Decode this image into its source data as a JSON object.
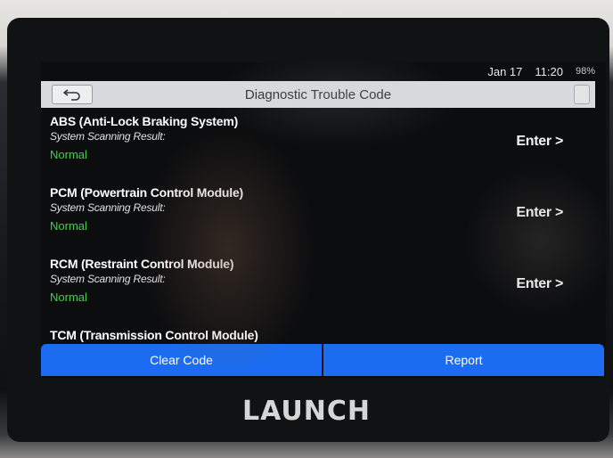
{
  "status_bar": {
    "date": "Jan 17",
    "time": "11:20",
    "battery": "98%"
  },
  "header": {
    "title": "Diagnostic Trouble Code"
  },
  "systems": [
    {
      "name": "ABS (Anti-Lock Braking System)",
      "label": "System Scanning Result:",
      "status": "Normal",
      "action": "Enter >"
    },
    {
      "name": "PCM (Powertrain Control Module)",
      "label": "System Scanning Result:",
      "status": "Normal",
      "action": "Enter >"
    },
    {
      "name": "RCM (Restraint Control Module)",
      "label": "System Scanning Result:",
      "status": "Normal",
      "action": "Enter >"
    },
    {
      "name": "TCM (Transmission Control Module)"
    }
  ],
  "actions": {
    "clear_code": "Clear Code",
    "report": "Report"
  },
  "brand": "LAUNCH",
  "colors": {
    "status_normal": "#3bd24a",
    "action_blue": "#1b6cf0",
    "title_bar": "#d8dadd"
  }
}
